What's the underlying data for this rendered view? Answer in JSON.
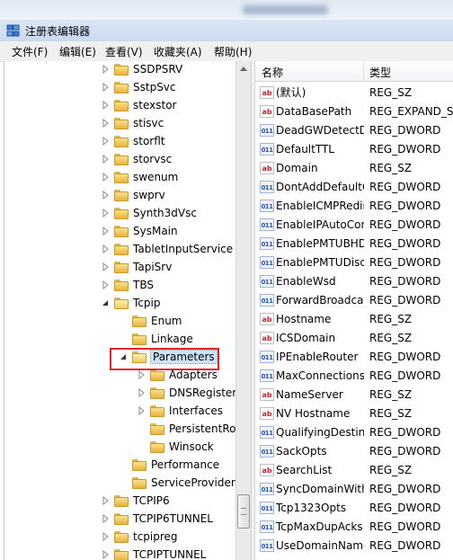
{
  "window": {
    "title": "注册表编辑器"
  },
  "menu": [
    "文件(F)",
    "编辑(E)",
    "查看(V)",
    "收藏夹(A)",
    "帮助(H)"
  ],
  "tree": [
    {
      "label": "SSDPSRV",
      "expand": "right",
      "level": 1,
      "open": false
    },
    {
      "label": "SstpSvc",
      "expand": "right",
      "level": 1,
      "open": false
    },
    {
      "label": "stexstor",
      "expand": "right",
      "level": 1,
      "open": false
    },
    {
      "label": "stisvc",
      "expand": "right",
      "level": 1,
      "open": false
    },
    {
      "label": "storflt",
      "expand": "right",
      "level": 1,
      "open": false
    },
    {
      "label": "storvsc",
      "expand": "right",
      "level": 1,
      "open": false
    },
    {
      "label": "swenum",
      "expand": "right",
      "level": 1,
      "open": false
    },
    {
      "label": "swprv",
      "expand": "right",
      "level": 1,
      "open": false
    },
    {
      "label": "Synth3dVsc",
      "expand": "right",
      "level": 1,
      "open": false
    },
    {
      "label": "SysMain",
      "expand": "right",
      "level": 1,
      "open": false
    },
    {
      "label": "TabletInputService",
      "expand": "right",
      "level": 1,
      "open": false
    },
    {
      "label": "TapiSrv",
      "expand": "right",
      "level": 1,
      "open": false
    },
    {
      "label": "TBS",
      "expand": "right",
      "level": 1,
      "open": false
    },
    {
      "label": "Tcpip",
      "expand": "down",
      "level": 1,
      "open": true
    },
    {
      "label": "Enum",
      "expand": "none",
      "level": 2,
      "open": false
    },
    {
      "label": "Linkage",
      "expand": "none",
      "level": 2,
      "open": false
    },
    {
      "label": "Parameters",
      "expand": "down",
      "level": 2,
      "open": true,
      "selected": true
    },
    {
      "label": "Adapters",
      "expand": "right",
      "level": 3,
      "open": false
    },
    {
      "label": "DNSRegisteredAdapters",
      "expand": "right",
      "level": 3,
      "open": false
    },
    {
      "label": "Interfaces",
      "expand": "right",
      "level": 3,
      "open": false
    },
    {
      "label": "PersistentRoutes",
      "expand": "none",
      "level": 3,
      "open": false
    },
    {
      "label": "Winsock",
      "expand": "none",
      "level": 3,
      "open": false
    },
    {
      "label": "Performance",
      "expand": "none",
      "level": 2,
      "open": false
    },
    {
      "label": "ServiceProvider",
      "expand": "none",
      "level": 2,
      "open": false
    },
    {
      "label": "TCPIP6",
      "expand": "right",
      "level": 1,
      "open": false
    },
    {
      "label": "TCPIP6TUNNEL",
      "expand": "right",
      "level": 1,
      "open": false
    },
    {
      "label": "tcpipreg",
      "expand": "right",
      "level": 1,
      "open": false
    },
    {
      "label": "TCPIPTUNNEL",
      "expand": "right",
      "level": 1,
      "open": false
    }
  ],
  "list": {
    "headers": {
      "name": "名称",
      "type": "类型"
    },
    "rows": [
      {
        "name": "(默认)",
        "type": "REG_SZ",
        "icon": "sz"
      },
      {
        "name": "DataBasePath",
        "type": "REG_EXPAND_SZ",
        "icon": "sz"
      },
      {
        "name": "DeadGWDetectDefault",
        "type": "REG_DWORD",
        "icon": "dw"
      },
      {
        "name": "DefaultTTL",
        "type": "REG_DWORD",
        "icon": "dw"
      },
      {
        "name": "Domain",
        "type": "REG_SZ",
        "icon": "sz"
      },
      {
        "name": "DontAddDefaultGatewayDefault",
        "type": "REG_DWORD",
        "icon": "dw"
      },
      {
        "name": "EnableICMPRedirect",
        "type": "REG_DWORD",
        "icon": "dw"
      },
      {
        "name": "EnableIPAutoConfigurationLimits",
        "type": "REG_DWORD",
        "icon": "dw"
      },
      {
        "name": "EnablePMTUBHDetect",
        "type": "REG_DWORD",
        "icon": "dw"
      },
      {
        "name": "EnablePMTUDiscovery",
        "type": "REG_DWORD",
        "icon": "dw"
      },
      {
        "name": "EnableWsd",
        "type": "REG_DWORD",
        "icon": "dw"
      },
      {
        "name": "ForwardBroadcasts",
        "type": "REG_DWORD",
        "icon": "dw"
      },
      {
        "name": "Hostname",
        "type": "REG_SZ",
        "icon": "sz"
      },
      {
        "name": "ICSDomain",
        "type": "REG_SZ",
        "icon": "sz"
      },
      {
        "name": "IPEnableRouter",
        "type": "REG_DWORD",
        "icon": "dw"
      },
      {
        "name": "MaxConnectionsPerServer",
        "type": "REG_DWORD",
        "icon": "dw"
      },
      {
        "name": "NameServer",
        "type": "REG_SZ",
        "icon": "sz"
      },
      {
        "name": "NV Hostname",
        "type": "REG_SZ",
        "icon": "sz"
      },
      {
        "name": "QualifyingDestinationThreshold",
        "type": "REG_DWORD",
        "icon": "dw"
      },
      {
        "name": "SackOpts",
        "type": "REG_DWORD",
        "icon": "dw"
      },
      {
        "name": "SearchList",
        "type": "REG_SZ",
        "icon": "sz"
      },
      {
        "name": "SyncDomainWithMembership",
        "type": "REG_DWORD",
        "icon": "dw"
      },
      {
        "name": "Tcp1323Opts",
        "type": "REG_DWORD",
        "icon": "dw"
      },
      {
        "name": "TcpMaxDupAcks",
        "type": "REG_DWORD",
        "icon": "dw"
      },
      {
        "name": "UseDomainNameDevolution",
        "type": "REG_DWORD",
        "icon": "dw"
      }
    ]
  },
  "icons": {
    "sz": "ab",
    "dw": "011"
  },
  "colors": {
    "highlight": "#e0252b",
    "selection": "#cde3f7"
  }
}
